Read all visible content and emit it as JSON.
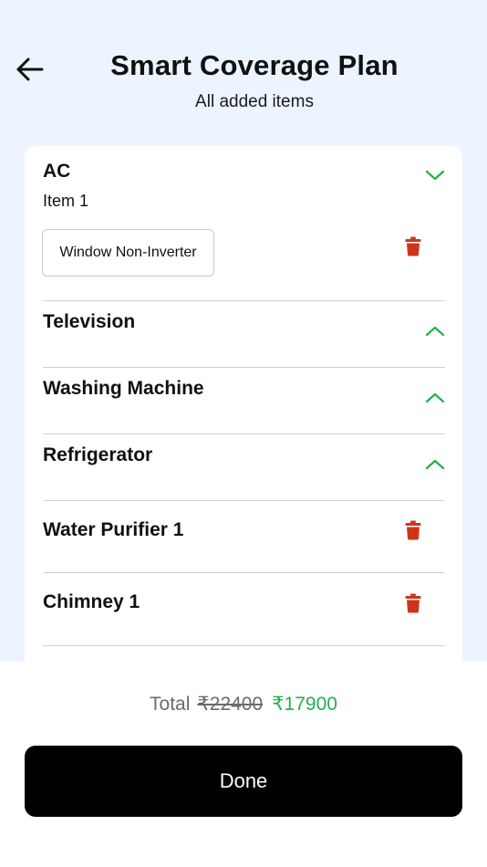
{
  "header": {
    "title": "Smart Coverage Plan",
    "subtitle": "All added items",
    "back_icon": "arrow-left-icon"
  },
  "items": {
    "ac": {
      "title": "AC",
      "sub_label": "Item 1",
      "variant": "Window Non-Inverter",
      "expanded": true
    },
    "television": {
      "title": "Television",
      "expanded": false
    },
    "washing_machine": {
      "title": "Washing Machine",
      "expanded": false
    },
    "refrigerator": {
      "title": "Refrigerator",
      "expanded": false
    },
    "water_purifier": {
      "title": "Water Purifier 1"
    },
    "chimney": {
      "title": "Chimney 1"
    }
  },
  "footer": {
    "total_label": "Total",
    "original_price": "₹22400",
    "discounted_price": "₹17900",
    "done_label": "Done"
  },
  "colors": {
    "accent_green": "#22b14c",
    "delete_red": "#d0341b",
    "background": "#ecf5ff"
  }
}
